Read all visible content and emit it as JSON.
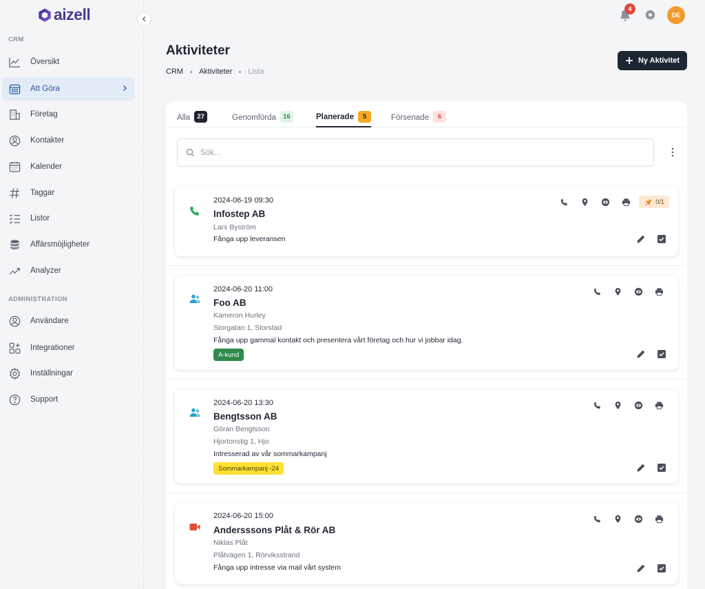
{
  "brand": {
    "name": "aizell"
  },
  "sidebar": {
    "sections": [
      {
        "label": "CRM",
        "items": [
          {
            "label": "Översikt",
            "icon": "chart-line-icon"
          },
          {
            "label": "Att Göra",
            "icon": "calendar-grid-icon",
            "active": true
          },
          {
            "label": "Företag",
            "icon": "building-icon"
          },
          {
            "label": "Kontakter",
            "icon": "user-circle-icon"
          },
          {
            "label": "Kalender",
            "icon": "calendar-icon"
          },
          {
            "label": "Taggar",
            "icon": "hashtag-icon"
          },
          {
            "label": "Listor",
            "icon": "checklist-icon"
          },
          {
            "label": "Affärsmöjligheter",
            "icon": "coins-icon"
          },
          {
            "label": "Analyzer",
            "icon": "trend-up-icon"
          }
        ]
      },
      {
        "label": "ADMINISTRATION",
        "items": [
          {
            "label": "Användare",
            "icon": "user-circle-icon"
          },
          {
            "label": "Integrationer",
            "icon": "apps-icon"
          },
          {
            "label": "Inställningar",
            "icon": "gear-icon"
          },
          {
            "label": "Support",
            "icon": "question-circle-icon"
          }
        ]
      }
    ]
  },
  "topbar": {
    "notifications": "4",
    "avatar_initials": "DE"
  },
  "header": {
    "title": "Aktiviteter",
    "breadcrumb": [
      "CRM",
      "Aktiviteter",
      "Lista"
    ],
    "new_button": "Ny Aktivitet"
  },
  "tabs": [
    {
      "label": "Alla",
      "count": "27",
      "color": "#1f2430",
      "text": "#ffffff"
    },
    {
      "label": "Genomförda",
      "count": "16",
      "color": "#dff3e6",
      "text": "#2f8a4c"
    },
    {
      "label": "Planerade",
      "count": "5",
      "color": "#f5a623",
      "text": "#1f2430",
      "active": true
    },
    {
      "label": "Försenade",
      "count": "6",
      "color": "#fde2e0",
      "text": "#d04a3f"
    }
  ],
  "search": {
    "placeholder": "Sök..."
  },
  "activities": [
    {
      "datetime": "2024-06-19 09:30",
      "company": "Infostep AB",
      "contact": "Lars Byström",
      "address": "",
      "description": "Fånga upp leveransen",
      "type_icon": "phone-icon",
      "type_color": "#2eae5a",
      "pin": "0/1"
    },
    {
      "datetime": "2024-06-20 11:00",
      "company": "Foo AB",
      "contact": "Kameron Hurley",
      "address": "Storgatan 1, Storstad",
      "description": "Fånga upp gammal kontakt och presentera vårt företag och hur vi jobbar idag.",
      "tag": "A-kund",
      "tag_color": "#2f8a4c",
      "tag_text_color": "#ffffff",
      "type_icon": "meeting-icon",
      "type_color": "#2ba3c9"
    },
    {
      "datetime": "2024-06-20 13:30",
      "company": "Bengtsson AB",
      "contact": "Göran Bengtsson",
      "address": "Hjortonstig 1, Hjo",
      "description": "Intresserad av vår sommarkampanj",
      "tag": "Sommarkampanj -24",
      "tag_color": "#ffe033",
      "tag_text_color": "#4a4200",
      "type_icon": "meeting-icon",
      "type_color": "#2ba3c9"
    },
    {
      "datetime": "2024-06-20 15:00",
      "company": "Andersssons Plåt & Rör AB",
      "contact": "Niklas Plåt",
      "address": "Plåtvägen 1, Rörviksstrand",
      "description": "Fånga upp intresse via mail vårt system",
      "type_icon": "video-icon",
      "type_color": "#e54b35"
    }
  ]
}
